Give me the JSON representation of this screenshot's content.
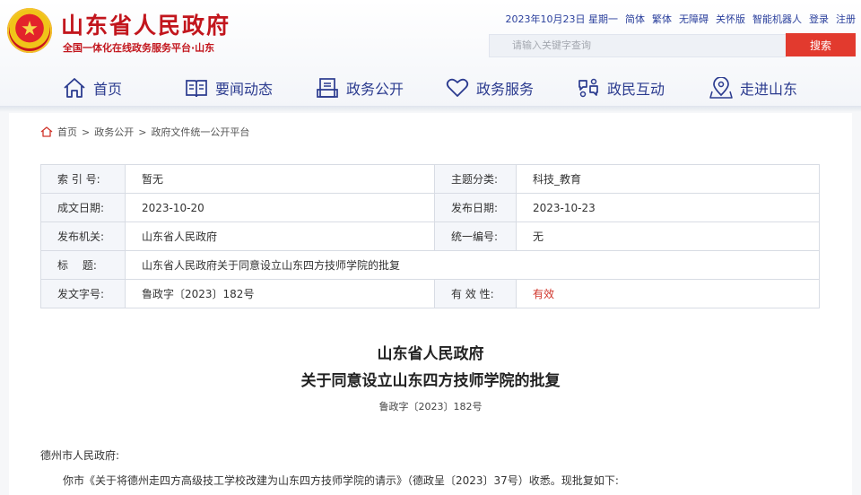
{
  "header": {
    "title": "山东省人民政府",
    "subtitle": "全国一体化在线政务服务平台·山东",
    "topbar": {
      "date": "2023年10月23日 星期一",
      "simplified": "简体",
      "traditional": "繁体",
      "accessibility": "无障碍",
      "elderly": "关怀版",
      "robot": "智能机器人",
      "login": "登录",
      "register": "注册"
    },
    "search": {
      "placeholder": "请输入关键字查询",
      "button": "搜索"
    },
    "nav": [
      {
        "label": "首页",
        "icon": "home-icon"
      },
      {
        "label": "要闻动态",
        "icon": "book-icon"
      },
      {
        "label": "政务公开",
        "icon": "document-icon"
      },
      {
        "label": "政务服务",
        "icon": "heart-icon"
      },
      {
        "label": "政民互动",
        "icon": "interaction-icon"
      },
      {
        "label": "走进山东",
        "icon": "location-icon"
      }
    ]
  },
  "breadcrumb": [
    "首页",
    "政务公开",
    "政府文件统一公开平台"
  ],
  "meta": {
    "index_label": "索 引 号:",
    "index_value": "暂无",
    "topic_label": "主题分类:",
    "topic_value": "科技_教育",
    "date_label": "成文日期:",
    "date_value": "2023-10-20",
    "publish_label": "发布日期:",
    "publish_value": "2023-10-23",
    "org_label": "发布机关:",
    "org_value": "山东省人民政府",
    "code_label": "统一编号:",
    "code_value": "无",
    "title_label": "标　 题:",
    "title_value": "山东省人民政府关于同意设立山东四方技师学院的批复",
    "docno_label": "发文字号:",
    "docno_value": "鲁政字〔2023〕182号",
    "validity_label": "有 效 性:",
    "validity_value": "有效"
  },
  "document": {
    "heading1": "山东省人民政府",
    "heading2": "关于同意设立山东四方技师学院的批复",
    "number": "鲁政字〔2023〕182号",
    "salutation": "德州市人民政府:",
    "paragraph1": "你市《关于将德州走四方高级技工学校改建为山东四方技师学院的请示》（德政呈〔2023〕37号）收悉。现批复如下:"
  },
  "colors": {
    "brand_red": "#c2161d",
    "nav_blue": "#2b3b8f",
    "search_button": "#e23a2e",
    "valid_red": "#d0342a"
  }
}
